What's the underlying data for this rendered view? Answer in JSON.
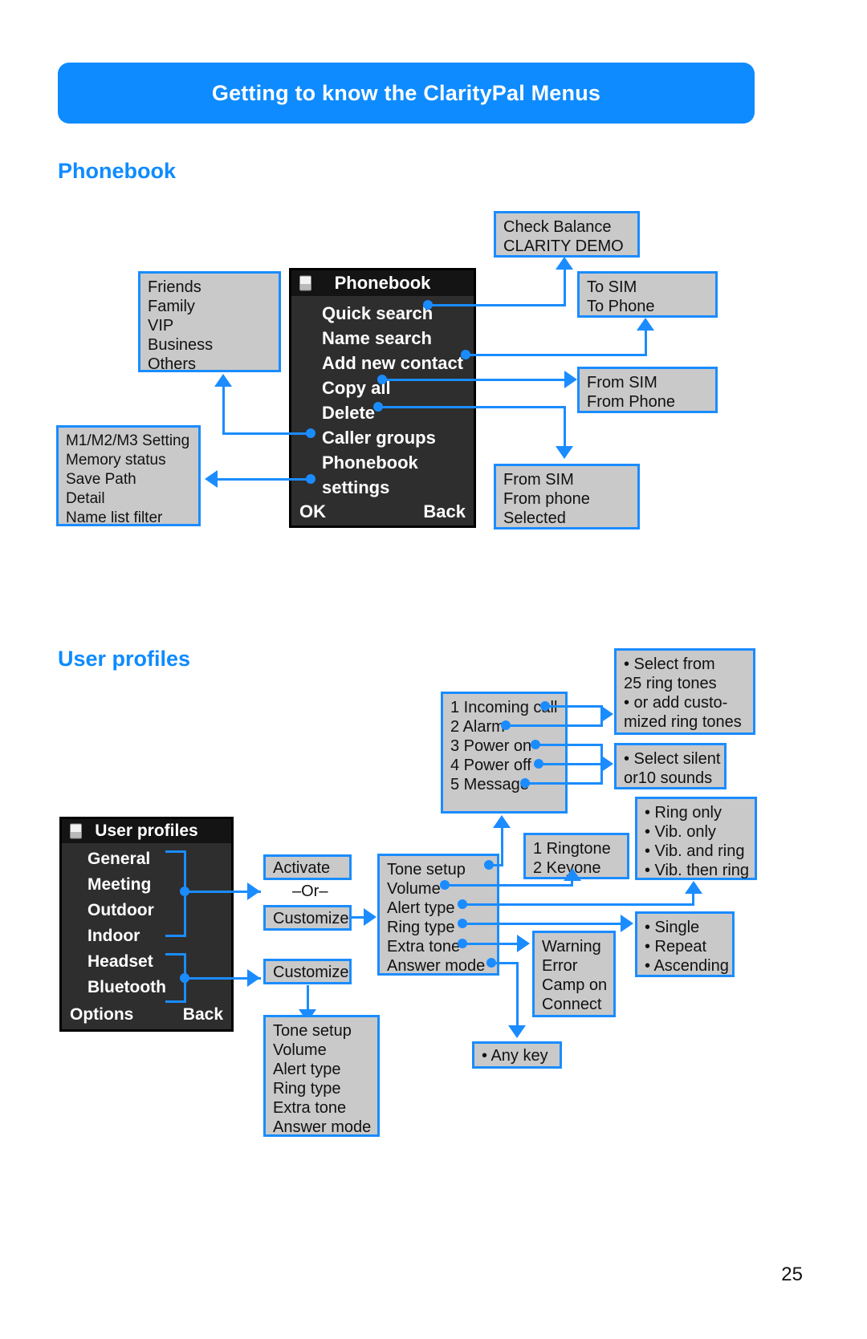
{
  "banner": {
    "title": "Getting to know the ClarityPal Menus"
  },
  "page_number": "25",
  "sections": {
    "phonebook": {
      "heading": "Phonebook",
      "phone": {
        "title": "Phonebook",
        "sim_icon": "sim-card-icon",
        "menu": [
          "Quick search",
          "Name search",
          "Add new contact",
          "Copy all",
          "Delete",
          "Caller groups",
          "Phonebook",
          " settings"
        ],
        "softkey_left": "OK",
        "softkey_right": "Back"
      },
      "boxes": {
        "caller_groups": [
          "Friends",
          "Family",
          "VIP",
          "Business",
          "Others"
        ],
        "phonebook_settings": [
          "M1/M2/M3 Setting",
          "Memory status",
          "Save Path",
          "Detail",
          "Name list filter"
        ],
        "quick_search": [
          "Check Balance",
          "CLARITY DEMO"
        ],
        "add_new_contact": [
          "To SIM",
          "To Phone"
        ],
        "copy_all": [
          "From SIM",
          "From Phone"
        ],
        "delete": [
          "From SIM",
          "From phone",
          "Selected"
        ]
      }
    },
    "user_profiles": {
      "heading": "User profiles",
      "phone": {
        "title": "User profiles",
        "sim_icon": "sim-card-icon",
        "menu": [
          "General",
          "Meeting",
          "Outdoor",
          "Indoor",
          "Headset",
          "Bluetooth"
        ],
        "softkey_left": "Options",
        "softkey_right": "Back"
      },
      "boxes": {
        "activate": [
          "Activate"
        ],
        "or_label": "–Or–",
        "customize_top": [
          "Customize"
        ],
        "customize_bottom": [
          "Customize"
        ],
        "customize_menu": [
          "Tone setup",
          "Volume",
          "Alert type",
          "Ring type",
          "Extra tone",
          "Answer mode"
        ],
        "tone_setup_menu": [
          "Tone setup",
          "Volume",
          "Alert type",
          "Ring type",
          "Extra tone",
          "Answer mode"
        ],
        "tone_items": [
          "1 Incoming call",
          "2 Alarm",
          "3 Power on",
          "4 Power off",
          "5 Message"
        ],
        "ring_tones": [
          "• Select from",
          "  25 ring tones",
          "• or add custo-",
          "  mized ring tones"
        ],
        "silent_sounds": [
          "• Select silent",
          "  or10 sounds"
        ],
        "volume_levels": [
          "1 Ringtone",
          "2 Keyone"
        ],
        "alert_types": [
          "• Ring only",
          "• Vib. only",
          "• Vib. and ring",
          "• Vib. then ring"
        ],
        "ring_types": [
          "• Single",
          "• Repeat",
          "• Ascending"
        ],
        "extra_tones": [
          "Warning",
          "Error",
          "Camp on",
          "Connect"
        ],
        "answer_mode": [
          "• Any key"
        ]
      }
    }
  },
  "colors": {
    "accent": "#0e8bff",
    "connector": "#1a8cff",
    "box_fill": "#c9c9c9",
    "lcd_bg": "#2e2e2e",
    "lcd_title_bg": "#141414"
  }
}
